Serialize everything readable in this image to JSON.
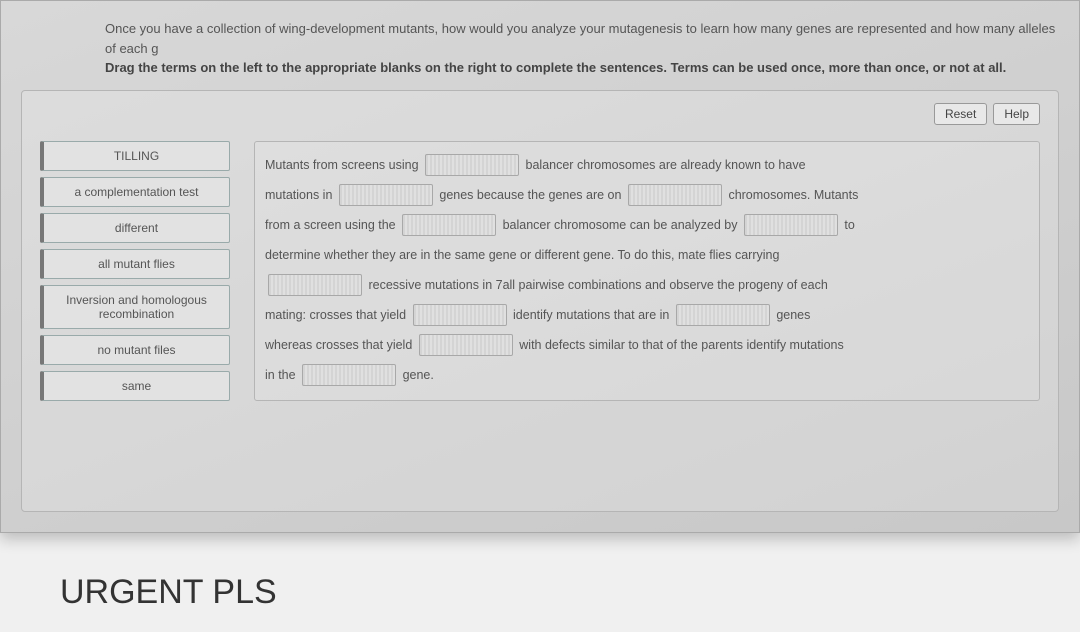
{
  "intro": {
    "line1": "Once you have a collection of wing-development mutants, how would you analyze your mutagenesis to learn how many genes are represented and how many alleles of each g",
    "line2": "Drag the terms on the left to the appropriate blanks on the right to complete the sentences. Terms can be used once, more than once, or not at all."
  },
  "buttons": {
    "reset": "Reset",
    "help": "Help"
  },
  "terms": [
    "TILLING",
    "a complementation test",
    "different",
    "all mutant flies",
    "Inversion and homologous recombination",
    "no mutant files",
    "same"
  ],
  "sentence": {
    "p1a": "Mutants from screens using",
    "p1b": "balancer chromosomes are already known to have",
    "p2a": "mutations in",
    "p2b": "genes because the genes are on",
    "p2c": "chromosomes. Mutants",
    "p3a": "from a screen using the",
    "p3b": "balancer chromosome can be analyzed by",
    "p3c": "to",
    "p4a": "determine whether they are in the same gene or different gene. To do this, mate flies carrying",
    "p5a": "recessive mutations in 7all pairwise combinations and observe the progeny of each",
    "p6a": "mating: crosses that yield",
    "p6b": "identify mutations that are in",
    "p6c": "genes",
    "p7a": "whereas crosses that yield",
    "p7b": "with defects similar to that of the parents identify mutations",
    "p8a": "in the",
    "p8b": "gene."
  },
  "footer": "URGENT PLS"
}
